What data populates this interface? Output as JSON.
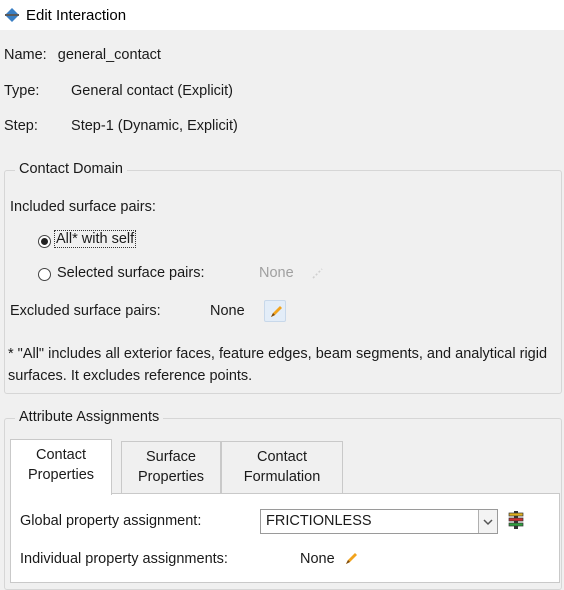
{
  "window": {
    "title": "Edit Interaction",
    "icon": "interaction-icon"
  },
  "info": {
    "name_label": "Name:",
    "name_value": "general_contact",
    "type_label": "Type:",
    "type_value": "General contact (Explicit)",
    "step_label": "Step:",
    "step_value": "Step-1 (Dynamic, Explicit)"
  },
  "contact_domain": {
    "title": "Contact Domain",
    "included_label": "Included surface pairs:",
    "options": [
      {
        "label": "All* with self",
        "selected": true
      },
      {
        "label": "Selected surface pairs:",
        "selected": false,
        "value": "None"
      }
    ],
    "excluded_label": "Excluded surface pairs:",
    "excluded_value": "None",
    "note": "* \"All\" includes all exterior faces, feature edges, beam segments, and analytical rigid surfaces. It excludes reference points."
  },
  "attributes": {
    "title": "Attribute Assignments",
    "tabs": [
      {
        "line1": "Contact",
        "line2": "Properties",
        "active": true
      },
      {
        "line1": "Surface",
        "line2": "Properties",
        "active": false
      },
      {
        "line1": "Contact",
        "line2": "Formulation",
        "active": false
      }
    ],
    "global_label": "Global property assignment:",
    "global_value": "FRICTIONLESS",
    "individual_label": "Individual property assignments:",
    "individual_value": "None"
  },
  "colors": {
    "accent_pencil": "#f0a020",
    "tab_panel": "#ffffff",
    "background": "#f0f0f0"
  }
}
